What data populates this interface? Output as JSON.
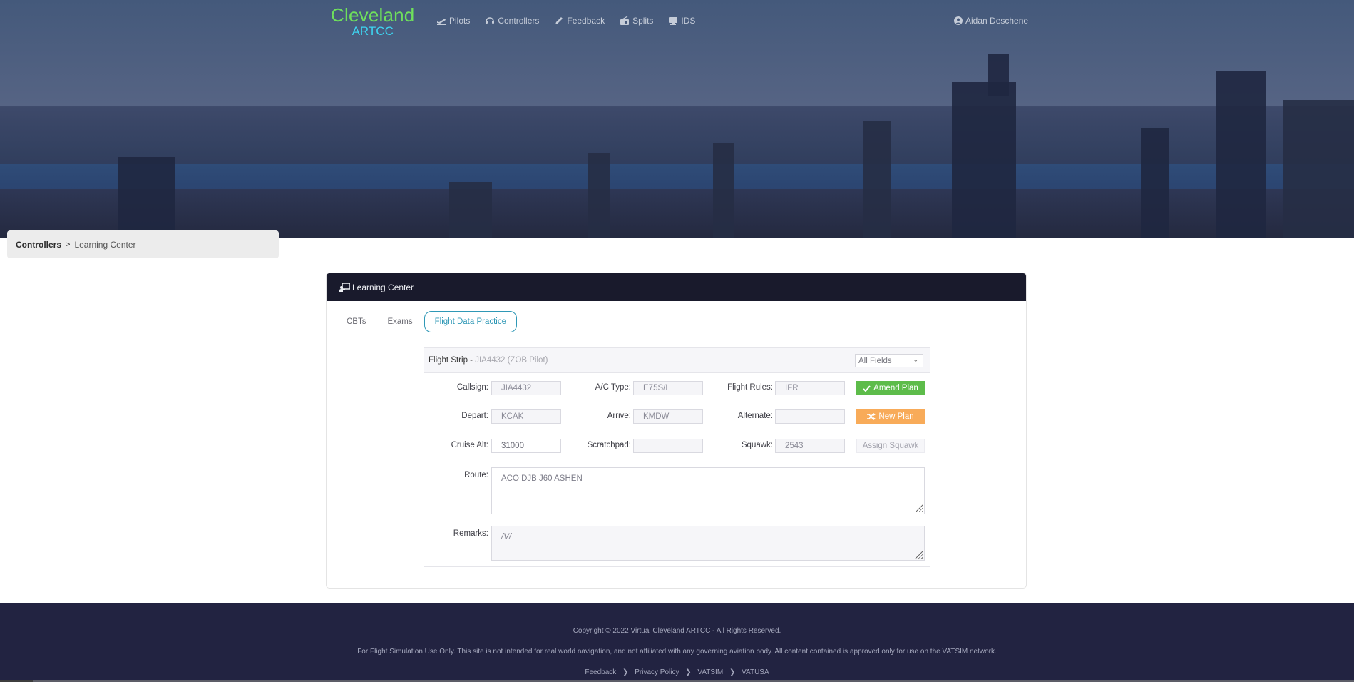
{
  "brand": {
    "line1": "Cleveland",
    "line2": "ARTCC"
  },
  "nav": {
    "items": [
      {
        "label": "Pilots",
        "icon": "plane-departure-icon"
      },
      {
        "label": "Controllers",
        "icon": "headset-icon"
      },
      {
        "label": "Feedback",
        "icon": "pencil-icon"
      },
      {
        "label": "Splits",
        "icon": "radio-icon"
      },
      {
        "label": "IDS",
        "icon": "desktop-icon"
      }
    ],
    "user": {
      "label": "Aidan Deschene",
      "icon": "user-circle-icon"
    }
  },
  "breadcrumb": {
    "parent": "Controllers",
    "separator": ">",
    "current": "Learning Center"
  },
  "card": {
    "title": "Learning Center",
    "icon": "chalkboard-teacher-icon",
    "tabs": [
      {
        "label": "CBTs",
        "active": false
      },
      {
        "label": "Exams",
        "active": false
      },
      {
        "label": "Flight Data Practice",
        "active": true
      }
    ]
  },
  "strip": {
    "title": "Flight Strip - ",
    "subtitle": "JIA4432 (ZOB Pilot)",
    "filter": {
      "selected": "All Fields"
    },
    "fields": {
      "callsign": {
        "label": "Callsign:",
        "value": "JIA4432"
      },
      "actype": {
        "label": "A/C Type:",
        "value": "E75S/L"
      },
      "rules": {
        "label": "Flight Rules:",
        "value": "IFR"
      },
      "depart": {
        "label": "Depart:",
        "value": "KCAK"
      },
      "arrive": {
        "label": "Arrive:",
        "value": "KMDW"
      },
      "alternate": {
        "label": "Alternate:",
        "value": ""
      },
      "cruise": {
        "label": "Cruise Alt:",
        "value": "31000"
      },
      "scratchpad": {
        "label": "Scratchpad:",
        "value": ""
      },
      "squawk": {
        "label": "Squawk:",
        "value": "2543"
      },
      "route": {
        "label": "Route:",
        "value": "ACO DJB J60 ASHEN"
      },
      "remarks": {
        "label": "Remarks:",
        "value": "/V/"
      }
    },
    "buttons": {
      "amend": {
        "label": "Amend Plan",
        "icon": "check-icon",
        "color": "#5dbc4a"
      },
      "new": {
        "label": "New Plan",
        "icon": "shuffle-icon",
        "color": "#f8ab59"
      },
      "assign": {
        "label": "Assign Squawk"
      }
    }
  },
  "footer": {
    "copyright": "Copyright © 2022 Virtual Cleveland ARTCC - All Rights Reserved.",
    "disclaimer": "For Flight Simulation Use Only. This site is not intended for real world navigation, and not affiliated with any governing aviation body. All content contained is approved only for use on the VATSIM network.",
    "links": [
      "Feedback",
      "Privacy Policy",
      "VATSIM",
      "VATUSA"
    ]
  }
}
